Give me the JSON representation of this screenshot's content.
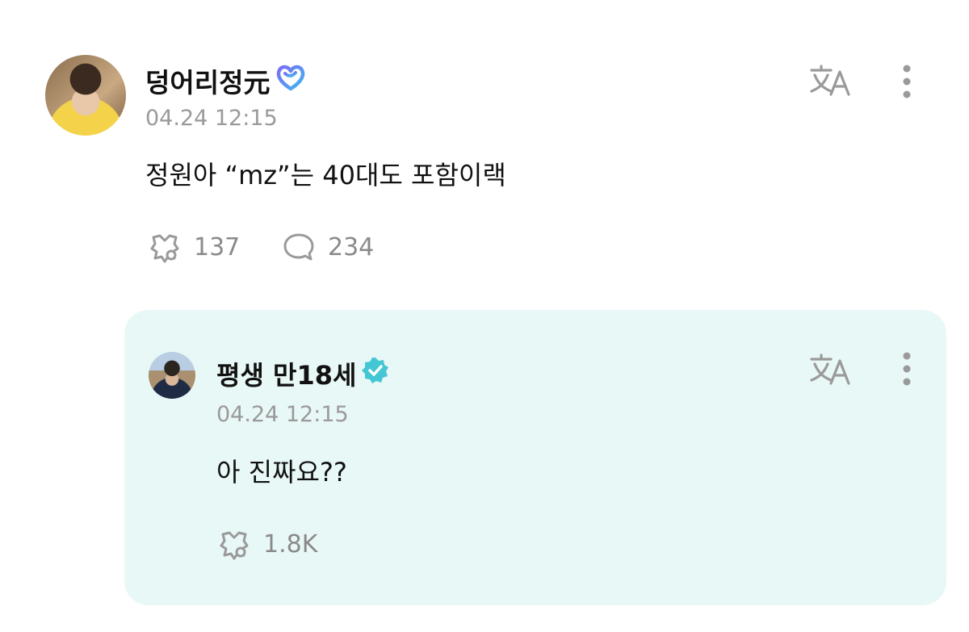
{
  "post": {
    "author": "덩어리정元",
    "timestamp": "04.24 12:15",
    "text": "정원아 “mz”는 40대도 포함이랙",
    "reactions": "137",
    "comments": "234"
  },
  "reply": {
    "author": "평생 만18세",
    "timestamp": "04.24 12:15",
    "text": "아 진짜요??",
    "reactions": "1.8K"
  },
  "icons": {
    "translate": "translate-icon",
    "more": "more-vertical-icon",
    "reaction": "reaction-icon",
    "comment": "comment-icon",
    "artist_badge": "artist-heart-badge-icon",
    "verified": "verified-badge-icon"
  },
  "colors": {
    "reply_background": "#e8f8f6",
    "verified": "#43c7d4",
    "badge_gradient_start": "#7b6cf6",
    "badge_gradient_end": "#3fb8f0"
  }
}
